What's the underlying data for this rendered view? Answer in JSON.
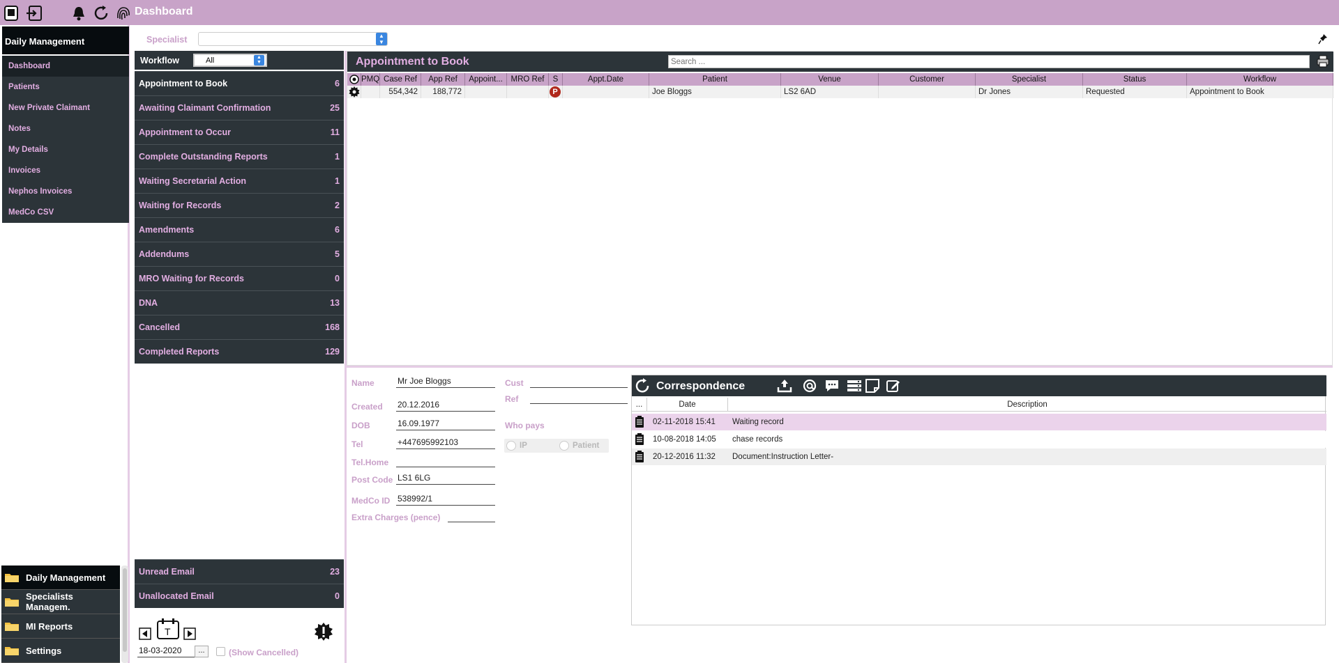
{
  "header": {
    "title": "Dashboard"
  },
  "sidebar": {
    "section_title": "Daily Management",
    "items": [
      {
        "label": "Dashboard"
      },
      {
        "label": "Patients"
      },
      {
        "label": "New Private Claimant"
      },
      {
        "label": "Notes"
      },
      {
        "label": "My Details"
      },
      {
        "label": "Invoices"
      },
      {
        "label": "Nephos Invoices"
      },
      {
        "label": "MedCo CSV"
      }
    ],
    "bottom_nav": [
      {
        "label": "Daily Management"
      },
      {
        "label": "Specialists Managem."
      },
      {
        "label": "MI Reports"
      },
      {
        "label": "Settings"
      }
    ]
  },
  "filter": {
    "specialist_label": "Specialist",
    "specialist_value": ""
  },
  "workflow": {
    "label": "Workflow",
    "selected": "All",
    "items": [
      {
        "label": "Appointment to Book",
        "count": "6"
      },
      {
        "label": "Awaiting Claimant Confirmation",
        "count": "25"
      },
      {
        "label": "Appointment to Occur",
        "count": "11"
      },
      {
        "label": "Complete Outstanding Reports",
        "count": "1"
      },
      {
        "label": "Waiting Secretarial Action",
        "count": "1"
      },
      {
        "label": "Waiting for Records",
        "count": "2"
      },
      {
        "label": "Amendments",
        "count": "6"
      },
      {
        "label": "Addendums",
        "count": "5"
      },
      {
        "label": "MRO Waiting for Records",
        "count": "0"
      },
      {
        "label": "DNA",
        "count": "13"
      },
      {
        "label": "Cancelled",
        "count": "168"
      },
      {
        "label": "Completed Reports",
        "count": "129"
      }
    ],
    "email": [
      {
        "label": "Unread Email",
        "count": "23"
      },
      {
        "label": "Unallocated Email",
        "count": "0"
      }
    ],
    "today_button": "T",
    "date": "18-03-2020",
    "date_picker": "...",
    "show_cancelled": "(Show Cancelled)"
  },
  "appointments": {
    "title": "Appointment to Book",
    "search_placeholder": "Search ...",
    "columns": [
      "PMQ",
      "Case Ref",
      "App Ref",
      "Appoint...",
      "MRO Ref",
      "S",
      "Appt.Date",
      "Patient",
      "Venue",
      "Customer",
      "Specialist",
      "Status",
      "Workflow"
    ],
    "rows": [
      {
        "pmq": "",
        "case_ref": "554,342",
        "app_ref": "188,772",
        "appoint": "",
        "mro_ref": "",
        "s": "P",
        "appt_date": "",
        "patient": "Joe Bloggs",
        "venue": "LS2 6AD",
        "customer": "",
        "specialist": "Dr Jones",
        "status": "Requested",
        "workflow": "Appointment to Book"
      }
    ]
  },
  "details": {
    "name_label": "Name",
    "name": "Mr Joe Bloggs",
    "created_label": "Created",
    "created": "20.12.2016",
    "dob_label": "DOB",
    "dob": "16.09.1977",
    "tel_label": "Tel",
    "tel": "+447695992103",
    "telhome_label": "Tel.Home",
    "telhome": "",
    "postcode_label": "Post Code",
    "postcode": "LS1 6LG",
    "medco_label": "MedCo ID",
    "medco": "538992/1",
    "extra_label": "Extra Charges (pence)",
    "extra": "",
    "cust_label": "Cust",
    "cust": "",
    "ref_label": "Ref",
    "ref": "",
    "whopays_label": "Who pays",
    "ip_label": "IP",
    "patient_label": "Patient"
  },
  "correspondence": {
    "title": "Correspondence",
    "columns": [
      "...",
      "Date",
      "Description"
    ],
    "rows": [
      {
        "date": "02-11-2018 15:41",
        "description": "Waiting record",
        "highlight": true
      },
      {
        "date": "10-08-2018 14:05",
        "description": "chase records",
        "highlight": false
      },
      {
        "date": "20-12-2016 11:32",
        "description": "Document:Instruction Letter-",
        "highlight": false
      }
    ]
  },
  "colors": {
    "accent": "#c8a3c8",
    "dark": "#2c3439",
    "label": "#c9a0c9",
    "highlight_row": "#ebd3eb"
  }
}
